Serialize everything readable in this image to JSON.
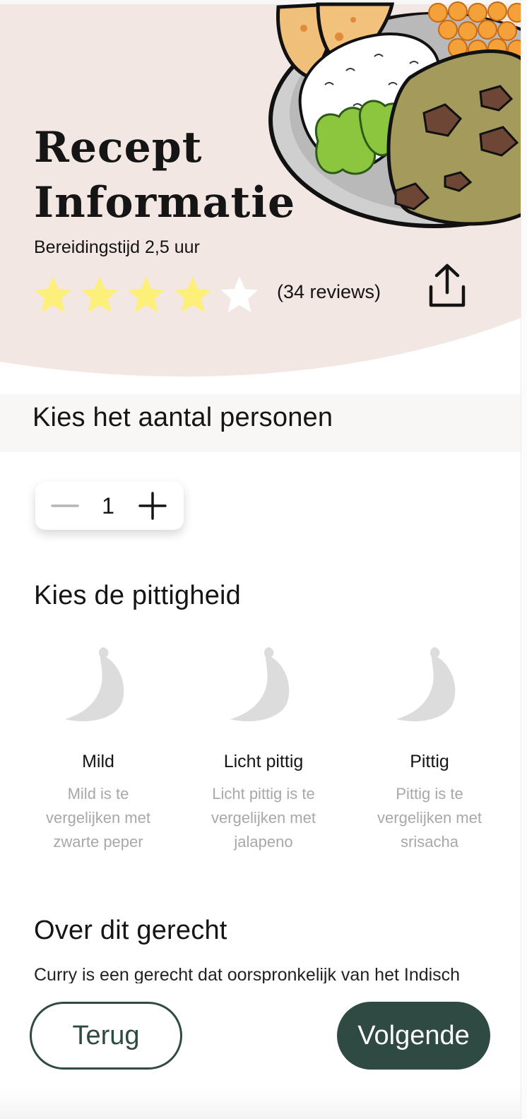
{
  "colors": {
    "hero_background": "#f3e7e3",
    "band_background": "#f9f7f5",
    "star_filled": "#fcef7a",
    "star_empty": "#ffffff",
    "pepper_inactive": "#dcdcdc",
    "accent": "#2f4a42",
    "muted_text": "#a8a8a8"
  },
  "header": {
    "title_line1": "Recept",
    "title_line2": "Informatie",
    "prep_time": "Bereidingstijd 2,5 uur",
    "rating": {
      "value": 4,
      "max": 5
    },
    "reviews": "(34 reviews)",
    "share_icon": "share-icon"
  },
  "persons": {
    "title": "Kies het aantal personen",
    "value": "1",
    "minus_icon": "minus-icon",
    "plus_icon": "plus-icon"
  },
  "spice": {
    "title": "Kies de pittigheid",
    "options": [
      {
        "name": "Mild",
        "desc_lines": [
          "Mild is te",
          "vergelijken met",
          "zwarte peper"
        ],
        "icon": "pepper-icon"
      },
      {
        "name": "Licht pittig",
        "desc_lines": [
          "Licht pittig is te",
          "vergelijken met",
          "jalapeno"
        ],
        "icon": "pepper-icon"
      },
      {
        "name": "Pittig",
        "desc_lines": [
          "Pittig is te",
          "vergelijken met",
          "srisacha"
        ],
        "icon": "pepper-icon"
      }
    ]
  },
  "about": {
    "title": "Over dit gerecht",
    "text": "Curry is een gerecht dat oorspronkelijk van het Indisch"
  },
  "footer": {
    "back_label": "Terug",
    "next_label": "Volgende"
  }
}
